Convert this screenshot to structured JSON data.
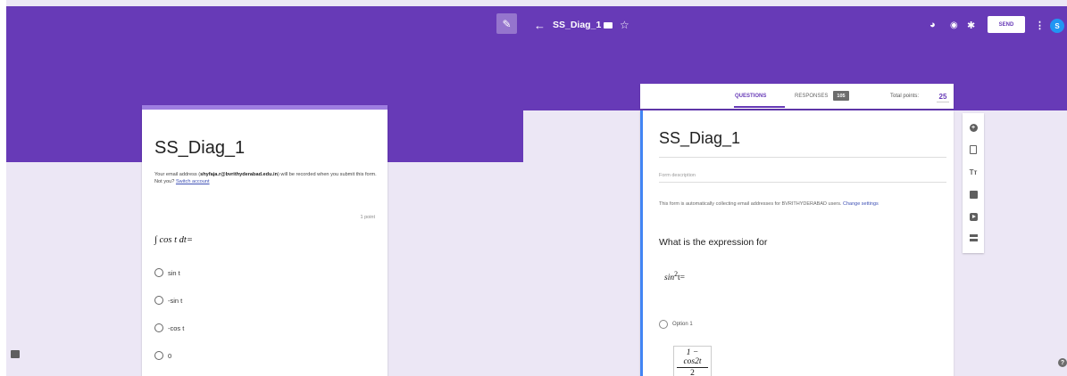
{
  "respondent": {
    "edit_icon_glyph": "✎",
    "form_title": "SS_Diag_1",
    "email_notice_prefix": "Your email address (",
    "email": "shyfaja.r@bvrithyderabad.edu.in",
    "email_notice_suffix": ") will be recorded when you submit this form. Not you? ",
    "switch_account": "Switch account",
    "points": "1 point",
    "question": "∫ cos t dt=",
    "options": [
      "sin t",
      "-sin t",
      "-cos t",
      "0"
    ]
  },
  "editor": {
    "back_glyph": "←",
    "form_title": "SS_Diag_1",
    "star_glyph": "☆",
    "palette_glyph": "◕",
    "preview_glyph": "◉",
    "settings_glyph": "✱",
    "send_label": "SEND",
    "more_glyph": "⋮",
    "avatar_initial": "S",
    "tabs": {
      "questions": "QUESTIONS",
      "responses": "RESPONSES",
      "responses_count": "105"
    },
    "total_points_label": "Total points:",
    "total_points_value": "25",
    "title": "SS_Diag_1",
    "description_placeholder": "Form description",
    "info_text": "This form is automatically collecting email addresses for BVRITHYDERABAD users. ",
    "change_settings": "Change settings",
    "question_title": "What is the expression for",
    "expression_base": "sin",
    "expression_exp": "2",
    "expression_rest": "t=",
    "option_label": "Option 1",
    "option_numerator": "1 − cos2t",
    "option_denominator": "2",
    "tool_title_glyph": "Tт",
    "help_glyph": "?"
  },
  "colors": {
    "brand": "#673ab7",
    "accent_blue": "#4285f4",
    "background": "#ece7f5"
  },
  "icons": [
    "edit-icon",
    "feedback-icon",
    "back-arrow-icon",
    "folder-icon",
    "star-icon",
    "palette-icon",
    "preview-icon",
    "settings-icon",
    "more-icon",
    "add-question-icon",
    "import-icon",
    "title-icon",
    "image-icon",
    "video-icon",
    "section-icon",
    "help-icon"
  ]
}
